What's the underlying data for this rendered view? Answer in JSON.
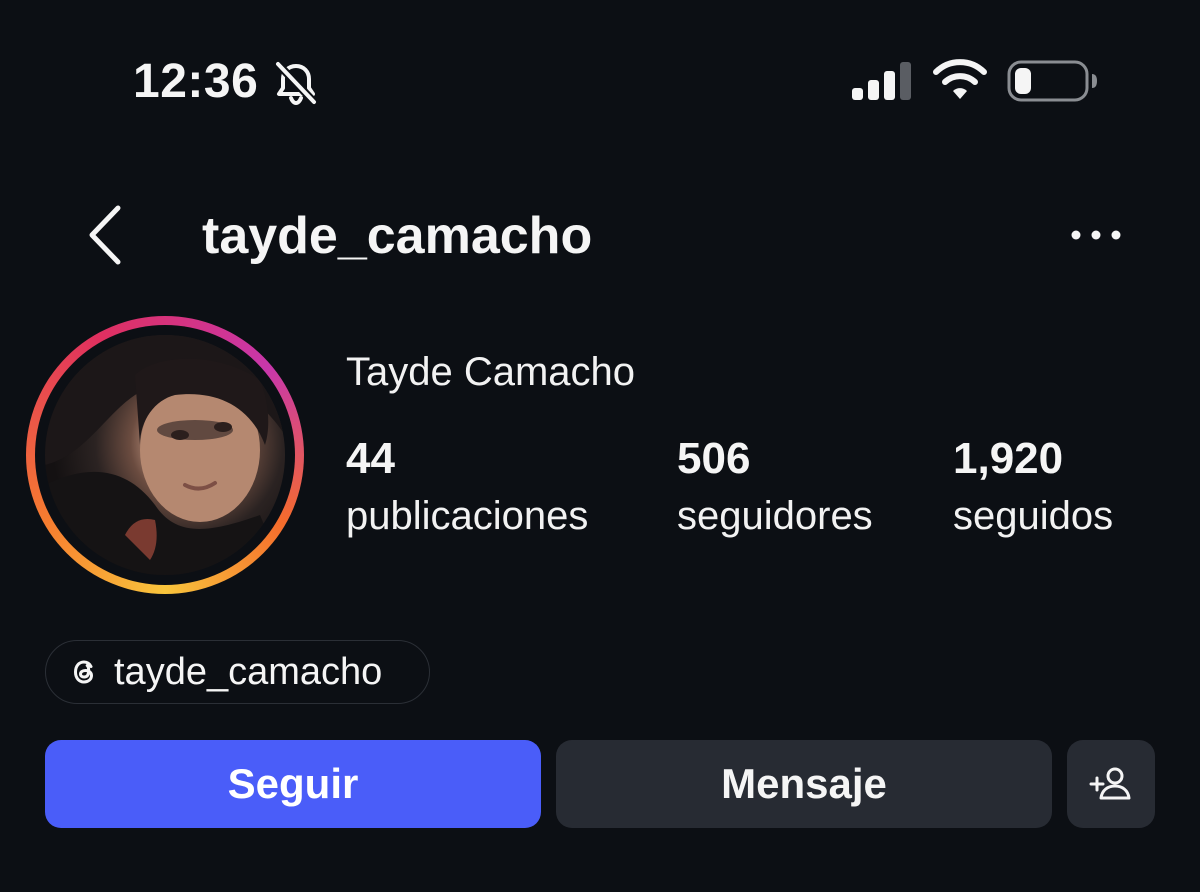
{
  "status_bar": {
    "time": "12:36",
    "icons": [
      "bell-slash-icon",
      "cellular-signal-icon",
      "wifi-icon",
      "battery-icon"
    ]
  },
  "header": {
    "username": "tayde_camacho",
    "icons": [
      "chevron-left-icon",
      "ellipsis-icon"
    ]
  },
  "profile": {
    "display_name": "Tayde Camacho",
    "stats": [
      {
        "value": "44",
        "label": "publicaciones"
      },
      {
        "value": "506",
        "label": "seguidores"
      },
      {
        "value": "1,920",
        "label": "seguidos"
      }
    ],
    "threads_handle": "tayde_camacho"
  },
  "actions": {
    "follow_label": "Seguir",
    "message_label": "Mensaje",
    "suggest_icon": "person-add-icon"
  },
  "colors": {
    "background": "#0c0f14",
    "primary_button": "#4a5df9",
    "secondary_button": "#272b33",
    "text": "#f5f5f5"
  }
}
